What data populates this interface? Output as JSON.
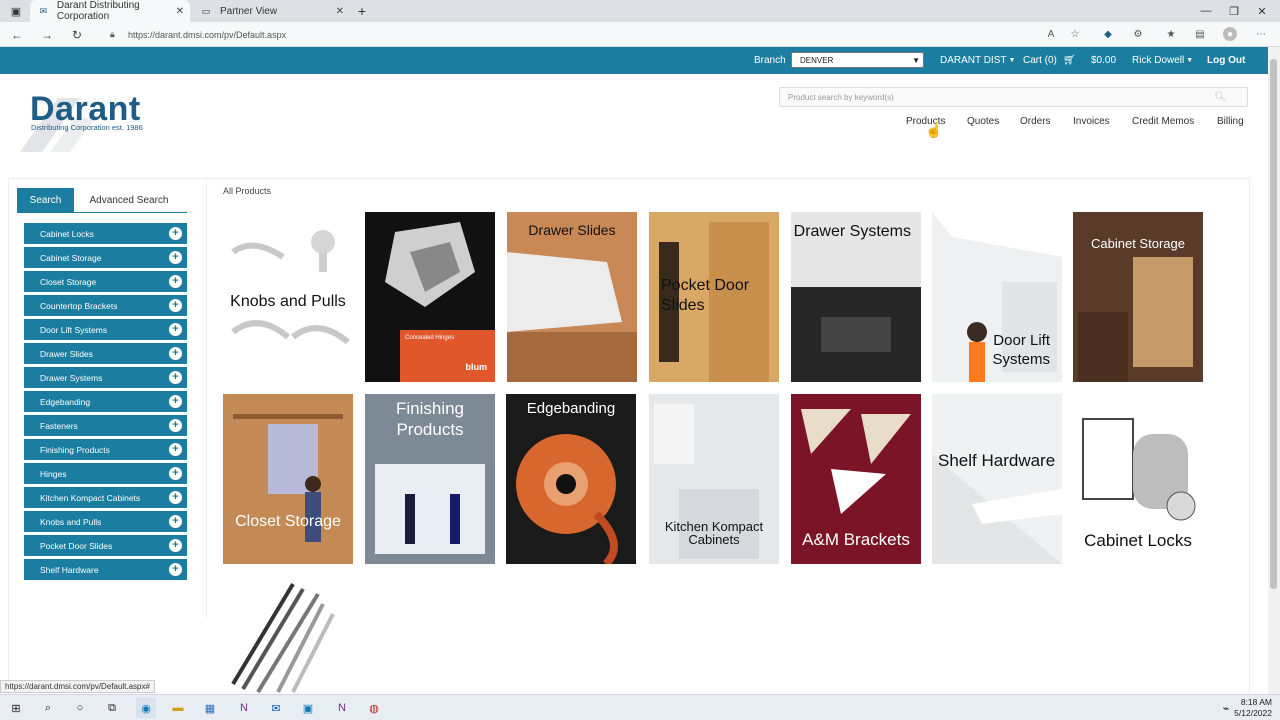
{
  "browser": {
    "tabs": [
      {
        "title": "Darant Distributing Corporation",
        "active": true
      },
      {
        "title": "Partner View",
        "active": false
      }
    ],
    "url": "https://darant.dmsi.com/pv/Default.aspx",
    "status_url": "https://darant.dmsi.com/pv/Default.aspx#"
  },
  "topnav": {
    "branch_label": "Branch",
    "branch_value": "DENVER",
    "account": "DARANT DIST",
    "cart": "Cart (0)",
    "cart_total": "$0.00",
    "user": "Rick Dowell",
    "logout": "Log Out"
  },
  "logo": {
    "name": "Darant",
    "sub": "Distributing Corporation",
    "est": "est. 1986"
  },
  "search": {
    "placeholder": "Product search by keyword(s)"
  },
  "mainnav": [
    "Products",
    "Quotes",
    "Orders",
    "Invoices",
    "Credit Memos",
    "Billing"
  ],
  "sidebar": {
    "tabs": [
      "Search",
      "Advanced Search"
    ],
    "categories": [
      "Cabinet Locks",
      "Cabinet Storage",
      "Closet Storage",
      "Countertop Brackets",
      "Door Lift Systems",
      "Drawer Slides",
      "Drawer Systems",
      "Edgebanding",
      "Fasteners",
      "Finishing Products",
      "Hinges",
      "Kitchen Kompact Cabinets",
      "Knobs and Pulls",
      "Pocket Door Slides",
      "Shelf Hardware"
    ]
  },
  "breadcrumb": "All Products",
  "tiles": [
    {
      "label": "Knobs and Pulls"
    },
    {
      "label": "",
      "sub": "Concealed Hinges",
      "brand": "blum"
    },
    {
      "label": "Drawer Slides"
    },
    {
      "label": "Pocket Door Slides"
    },
    {
      "label": "Drawer Systems"
    },
    {
      "label": "Door Lift Systems"
    },
    {
      "label": "Cabinet Storage"
    },
    {
      "label": "Closet Storage"
    },
    {
      "label": "Finishing Products"
    },
    {
      "label": "Edgebanding"
    },
    {
      "label": "Kitchen Kompact Cabinets"
    },
    {
      "label": "A&M Brackets"
    },
    {
      "label": "Shelf Hardware"
    },
    {
      "label": "Cabinet Locks"
    },
    {
      "label": ""
    }
  ],
  "taskbar": {
    "time": "8:18 AM",
    "date": "5/12/2022"
  },
  "colors": {
    "brand": "#1b7ea0",
    "logo": "#1e5d86"
  }
}
